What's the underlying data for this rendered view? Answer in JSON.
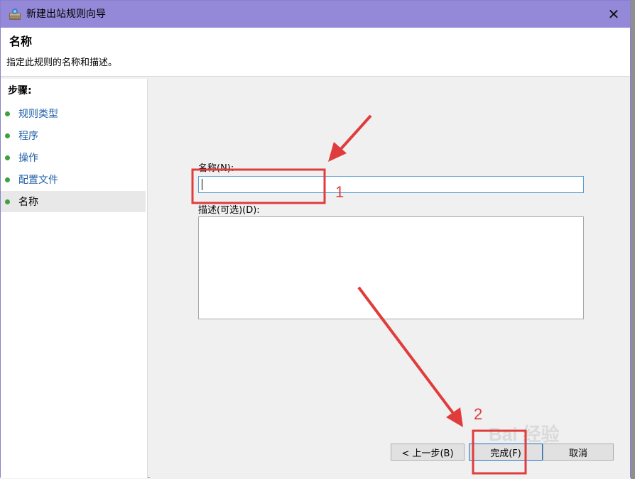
{
  "window": {
    "title": "新建出站规则向导",
    "close_glyph": "✕"
  },
  "header": {
    "title": "名称",
    "description": "指定此规则的名称和描述。"
  },
  "sidebar": {
    "title": "步骤:",
    "items": [
      {
        "label": "规则类型",
        "active": false
      },
      {
        "label": "程序",
        "active": false
      },
      {
        "label": "操作",
        "active": false
      },
      {
        "label": "配置文件",
        "active": false
      },
      {
        "label": "名称",
        "active": true
      }
    ]
  },
  "form": {
    "name_label": "名称(N):",
    "name_value": "",
    "description_label": "描述(可选)(D):",
    "description_value": ""
  },
  "buttons": {
    "back": "< 上一步(B)",
    "finish": "完成(F)",
    "cancel": "取消"
  },
  "annotations": {
    "step1": "1",
    "step2": "2"
  },
  "watermark": "Bai 经验",
  "colors": {
    "titlebar": "#9489d8",
    "annotation": "#e03c3c",
    "step_dot": "#3fa03f",
    "link": "#1f5fa8"
  }
}
